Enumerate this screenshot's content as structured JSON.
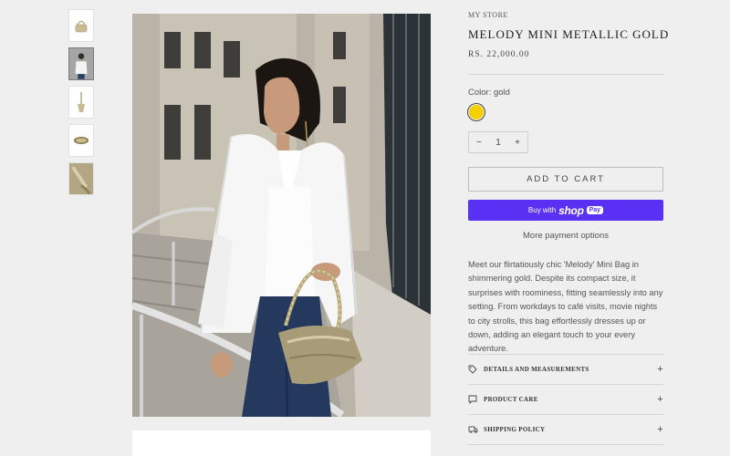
{
  "store": {
    "name": "MY STORE"
  },
  "product": {
    "title": "MELODY MINI METALLIC GOLD",
    "price": "RS. 22,000.00",
    "color_label": "Color: gold",
    "swatch_color": "#f4d000",
    "quantity": "1"
  },
  "buttons": {
    "qty_minus": "−",
    "qty_plus": "+",
    "add_to_cart": "ADD TO CART",
    "buy_with": "Buy with",
    "shop": "shop",
    "pay": "Pay",
    "more_payment": "More payment options"
  },
  "description": "Meet our flirtatiously chic 'Melody' Mini Bag in shimmering gold. Despite its compact size, it surprises with roominess, fitting seamlessly into any setting. From workdays to café visits, movie nights to city strolls, this bag effortlessly dresses up or down, adding an elegant touch to your every adventure.",
  "accordion": [
    {
      "label": "DETAILS AND MEASUREMENTS",
      "icon": "tag-icon",
      "toggle": "+"
    },
    {
      "label": "PRODUCT CARE",
      "icon": "chat-icon",
      "toggle": "+"
    },
    {
      "label": "SHIPPING POLICY",
      "icon": "truck-icon",
      "toggle": "+"
    }
  ],
  "colors": {
    "shop_pay": "#5a31f4",
    "background": "#efefef"
  }
}
